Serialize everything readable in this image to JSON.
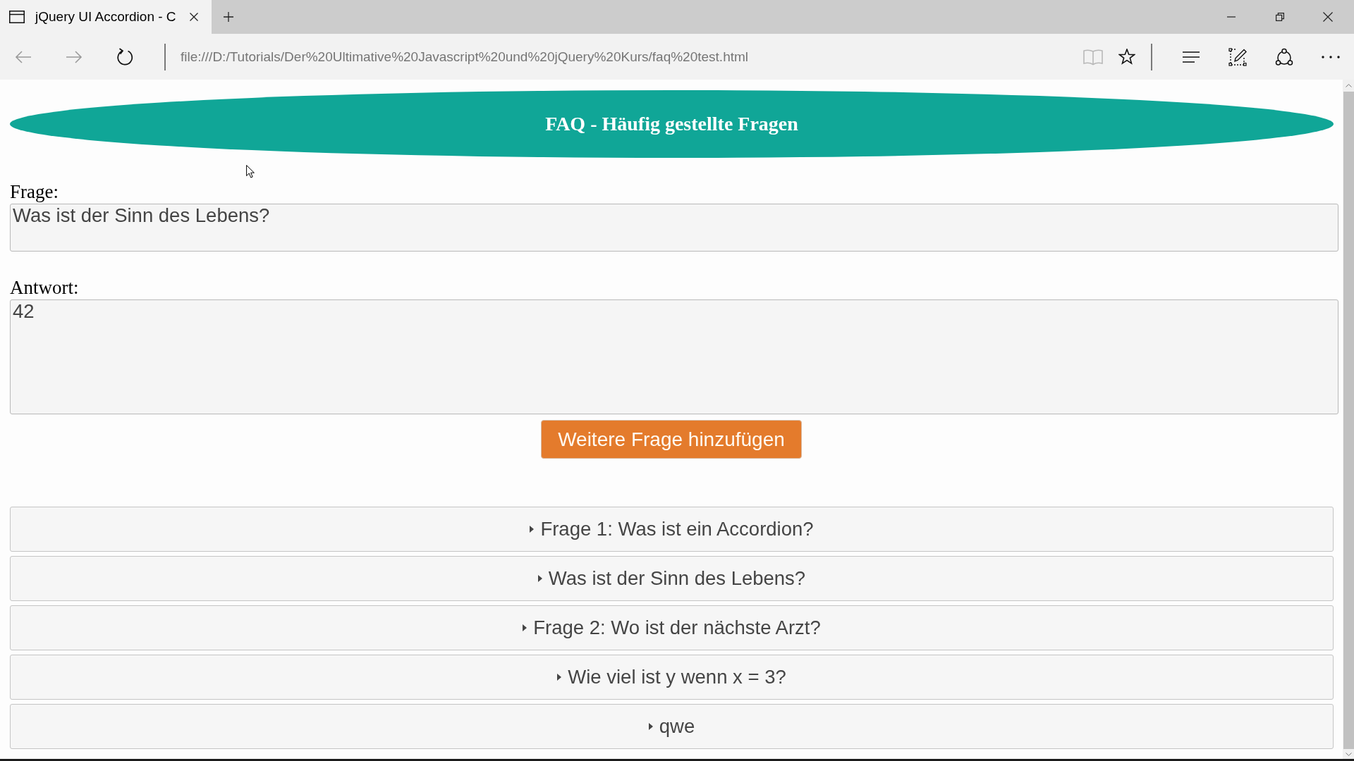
{
  "browser": {
    "tabs": [
      {
        "title": "jQuery UI Accordion - C",
        "selected": true
      }
    ],
    "nav_buttons": [
      {
        "kind": "back",
        "disabled": true
      },
      {
        "kind": "forward",
        "disabled": true
      },
      {
        "kind": "refresh",
        "disabled": false
      }
    ],
    "address": "file:///D:/Tutorials/Der%20Ultimative%20Javascript%20und%20jQuery%20Kurs/faq%20test.html",
    "page_actions": [
      {
        "kind": "reading-view",
        "disabled": true
      },
      {
        "kind": "favorite",
        "disabled": false
      }
    ]
  },
  "page": {
    "header": {
      "title": "FAQ - Häufig gestellte Fragen"
    },
    "form": {
      "question": {
        "label": "Frage:",
        "value": "Was ist der Sinn des Lebens?"
      },
      "answer": {
        "label": "Antwort:",
        "value": "42"
      },
      "add_button": "Weitere Frage hinzufügen"
    },
    "accordion": [
      {
        "title": "Frage 1: Was ist ein Accordion?",
        "expanded": false
      },
      {
        "title": "Was ist der Sinn des Lebens?",
        "expanded": false
      },
      {
        "title": "Frage 2: Wo ist der nächste Arzt?",
        "expanded": false
      },
      {
        "title": "Wie viel ist y wenn x = 3?",
        "expanded": false
      },
      {
        "title": "qwe",
        "expanded": false
      }
    ]
  }
}
